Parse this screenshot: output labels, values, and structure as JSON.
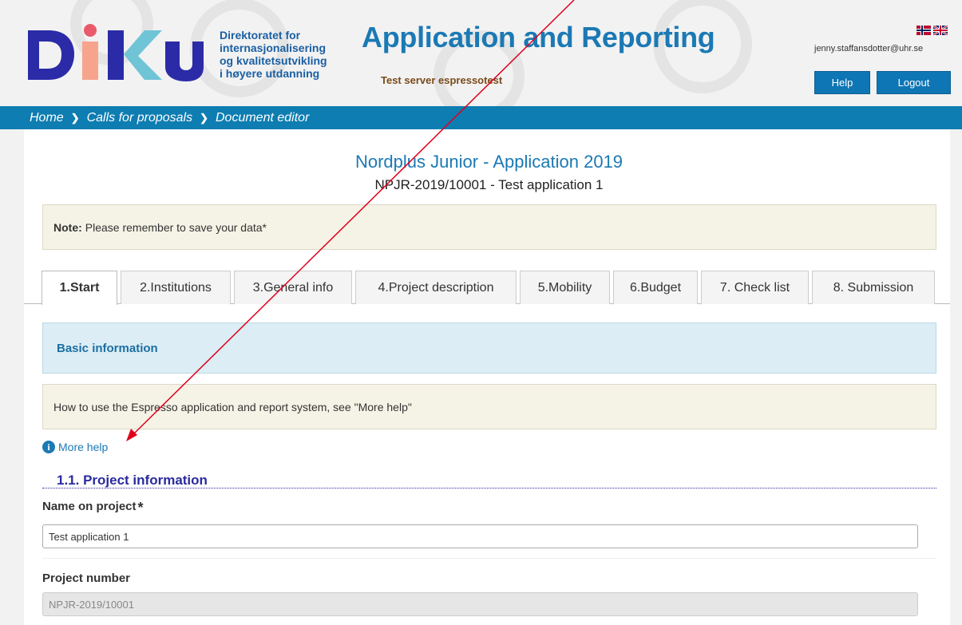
{
  "header": {
    "logo_text": "DIKU",
    "org_lines": [
      "Direktoratet for",
      "internasjonalisering",
      "og kvalitetsutvikling",
      "i høyere utdanning"
    ],
    "app_title": "Application and Reporting",
    "server_label": "Test server espressotest",
    "user_email": "jenny.staffansdotter@uhr.se",
    "help_label": "Help",
    "logout_label": "Logout",
    "flags": [
      "norway-flag-icon",
      "uk-flag-icon"
    ]
  },
  "breadcrumb": [
    "Home",
    "Calls for proposals",
    "Document editor"
  ],
  "page": {
    "title": "Nordplus Junior - Application 2019",
    "subtitle": "NPJR-2019/10001 - Test application 1"
  },
  "note": {
    "label": "Note:",
    "text": "Please remember to save your data*"
  },
  "tabs": [
    {
      "label": "1.Start",
      "active": true
    },
    {
      "label": "2.Institutions",
      "active": false
    },
    {
      "label": "3.General info",
      "active": false
    },
    {
      "label": "4.Project description",
      "active": false
    },
    {
      "label": "5.Mobility",
      "active": false
    },
    {
      "label": "6.Budget",
      "active": false
    },
    {
      "label": "7. Check list",
      "active": false
    },
    {
      "label": "8. Submission",
      "active": false
    }
  ],
  "basic_info": "Basic information",
  "howto": "How to use the Espresso application and report system, see \"More help\"",
  "more_help": "More help",
  "section": "1.1. Project information",
  "fields": {
    "name_label": "Name on project",
    "name_value": "Test application 1",
    "number_label": "Project number",
    "number_value": "NPJR-2019/10001"
  },
  "colors": {
    "brand_blue": "#1b79b4",
    "bar_blue": "#0e7db1",
    "annotation_red": "#e0001b"
  }
}
